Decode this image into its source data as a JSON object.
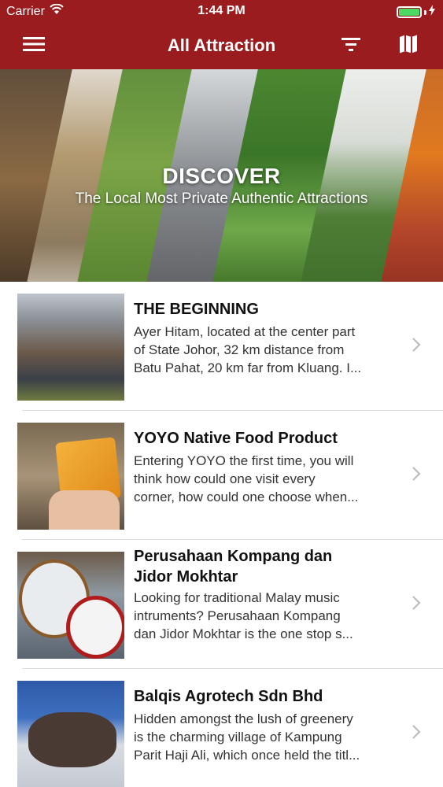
{
  "status_bar": {
    "carrier": "Carrier",
    "time": "1:44 PM"
  },
  "nav": {
    "title": "All Attraction",
    "menu_icon": "hamburger-icon",
    "filter_icon": "filter-icon",
    "map_icon": "map-icon"
  },
  "banner": {
    "heading": "DISCOVER",
    "subheading": "The Local Most Private Authentic Attractions"
  },
  "attractions": [
    {
      "title": "THE BEGINNING",
      "description_lines": [
        "Ayer Hitam, located at the center part",
        "of State Johor, 32 km distance from",
        "Batu Pahat, 20 km far from Kluang. I..."
      ]
    },
    {
      "title": "YOYO Native Food Product",
      "description_lines": [
        "Entering YOYO the first time, you will",
        "think how could one visit every",
        "corner, how could one choose when..."
      ]
    },
    {
      "title_lines": [
        "Perusahaan Kompang dan",
        "Jidor Mokhtar"
      ],
      "description_lines": [
        "Looking for traditional Malay music",
        "intruments? Perusahaan Kompang",
        "dan Jidor Mokhtar is the one stop s..."
      ]
    },
    {
      "title": "Balqis Agrotech Sdn Bhd",
      "description_lines": [
        "Hidden amongst the lush of greenery",
        "is the charming village of Kampung",
        "Parit Haji Ali, which once held the titl..."
      ]
    }
  ],
  "colors": {
    "brand": "#9b1c1f",
    "battery": "#4cd964"
  }
}
